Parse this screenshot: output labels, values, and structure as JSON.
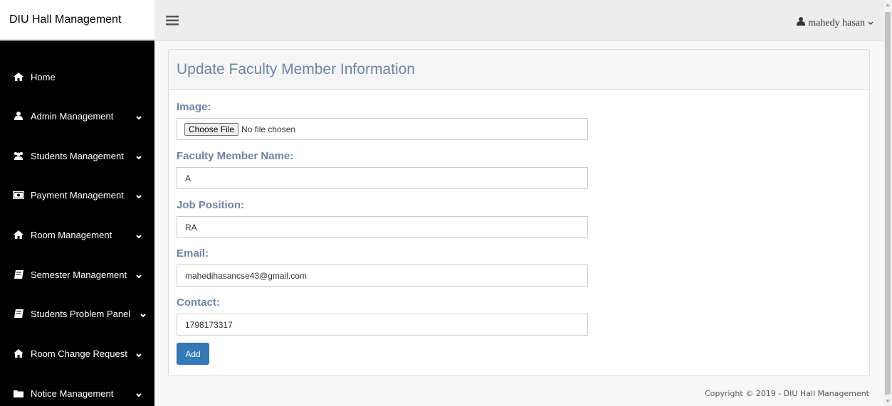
{
  "app": {
    "brand": "DIU Hall Management"
  },
  "topbar": {
    "user_name": "mahedy hasan"
  },
  "sidebar": {
    "items": [
      {
        "label": "Home",
        "icon": "home-icon",
        "has_dropdown": false
      },
      {
        "label": "Admin Management",
        "icon": "user-icon",
        "has_dropdown": true
      },
      {
        "label": "Students Management",
        "icon": "users-icon",
        "has_dropdown": true
      },
      {
        "label": "Payment Management",
        "icon": "money-icon",
        "has_dropdown": true
      },
      {
        "label": "Room Management",
        "icon": "home-icon",
        "has_dropdown": true
      },
      {
        "label": "Semester Management",
        "icon": "book-icon",
        "has_dropdown": true
      },
      {
        "label": "Students Problem Panel",
        "icon": "book-icon",
        "has_dropdown": true
      },
      {
        "label": "Room Change Request",
        "icon": "home-icon",
        "has_dropdown": true
      },
      {
        "label": "Notice Management",
        "icon": "folder-icon",
        "has_dropdown": true
      }
    ]
  },
  "form": {
    "title": "Update Faculty Member Information",
    "image_label": "Image:",
    "choose_file": "Choose File",
    "no_file": "No file chosen",
    "name_label": "Faculty Member Name:",
    "name_value": "A",
    "position_label": "Job Position:",
    "position_value": "RA",
    "email_label": "Email:",
    "email_value": "mahedihasancse43@gmail.com",
    "contact_label": "Contact:",
    "contact_value": "1798173317",
    "submit_label": "Add"
  },
  "footer": {
    "copyright": "Copyright © 2019 - DIU Hall Management"
  },
  "colors": {
    "sidebar_bg": "#000000",
    "label": "#6f84a3",
    "primary": "#337ab7"
  }
}
